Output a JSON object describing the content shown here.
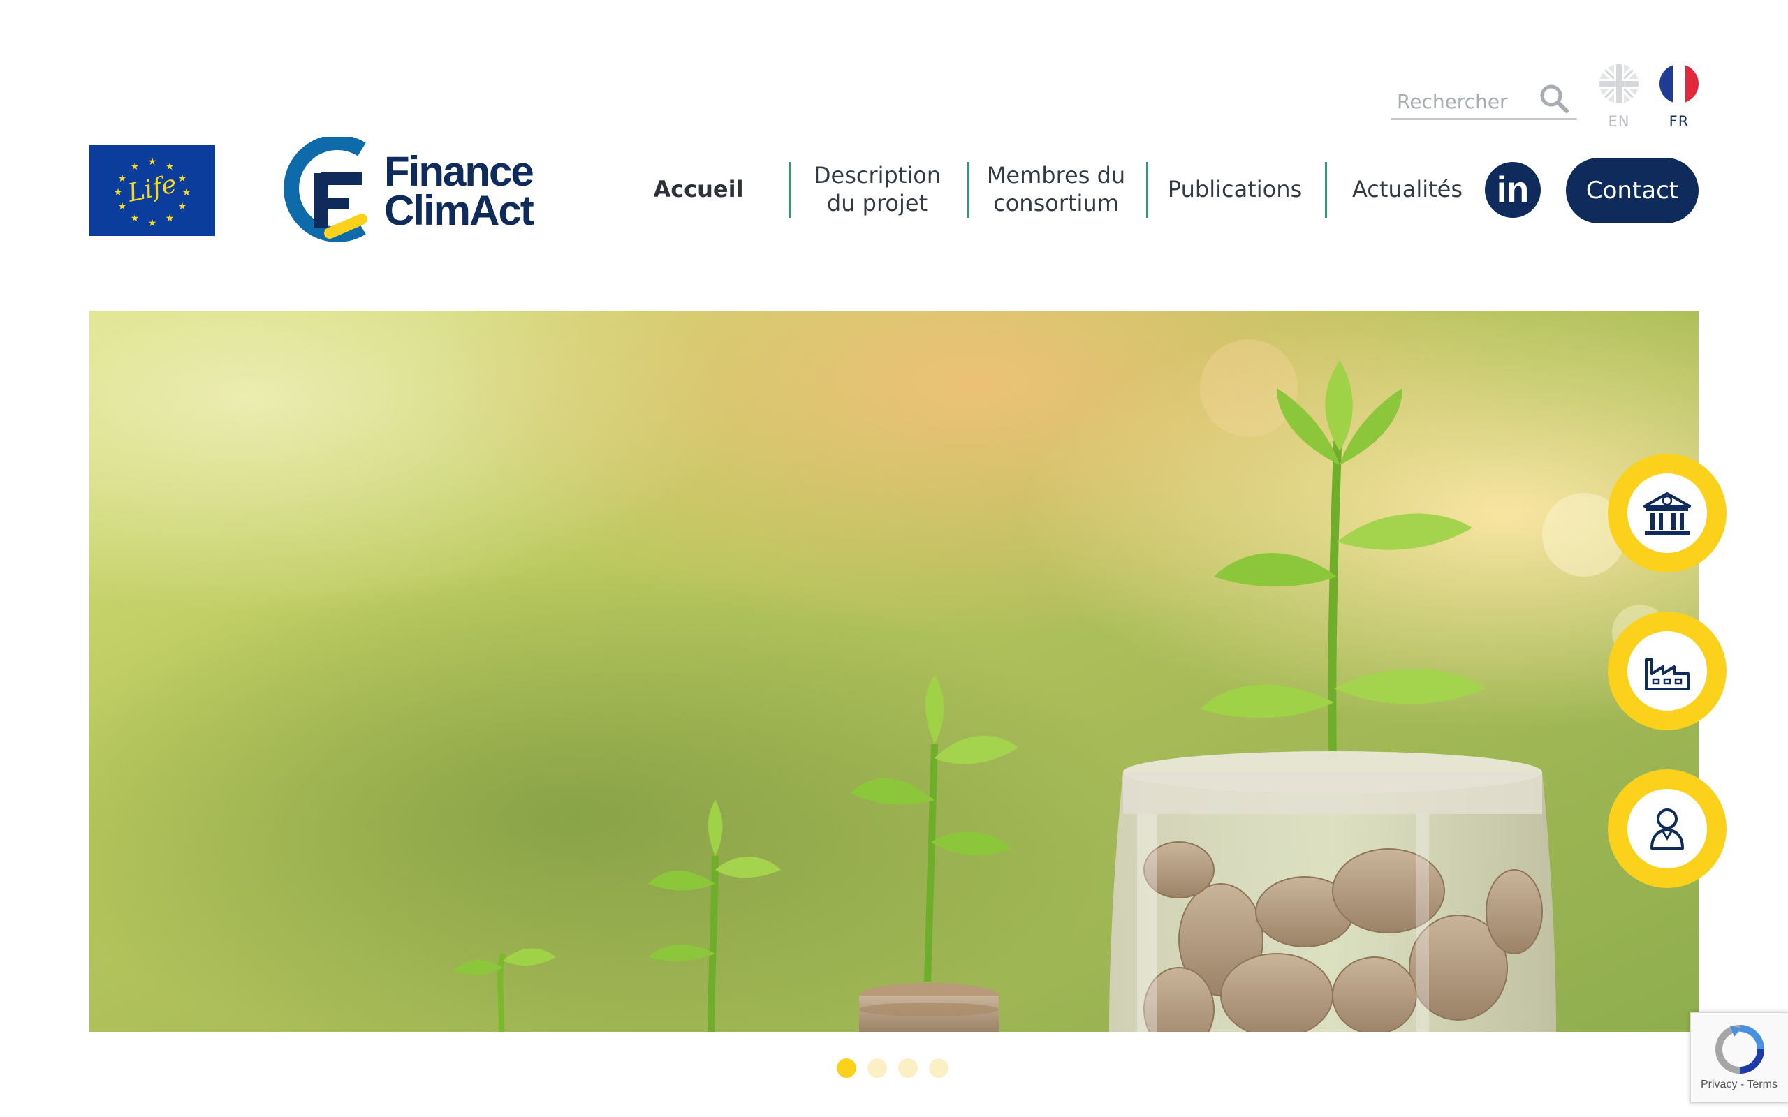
{
  "search": {
    "placeholder": "Rechercher"
  },
  "languages": [
    {
      "code": "EN",
      "active": false
    },
    {
      "code": "FR",
      "active": true
    }
  ],
  "eu_logo": {
    "text": "Life"
  },
  "brand": {
    "line1": "Finance",
    "line2": "ClimAct"
  },
  "nav": {
    "items": [
      {
        "line1": "Accueil",
        "line2": "",
        "active": true
      },
      {
        "line1": "Description",
        "line2": "du projet"
      },
      {
        "line1": "Membres du",
        "line2": "consortium"
      },
      {
        "line1": "Publications",
        "line2": ""
      },
      {
        "line1": "Actualités",
        "line2": ""
      }
    ],
    "linkedin_label": "in",
    "contact_label": "Contact"
  },
  "side_buttons": [
    {
      "icon": "bank-euro-icon"
    },
    {
      "icon": "factory-icon"
    },
    {
      "icon": "person-icon"
    }
  ],
  "slider": {
    "slide_count": 4,
    "active_index": 0
  },
  "recaptcha": {
    "privacy": "Privacy",
    "separator": " - ",
    "terms": "Terms"
  },
  "colors": {
    "navy": "#0e2b5c",
    "accent_yellow": "#fbd11c",
    "separator_green": "#2a9b6e",
    "eu_blue": "#0a3d9c"
  }
}
